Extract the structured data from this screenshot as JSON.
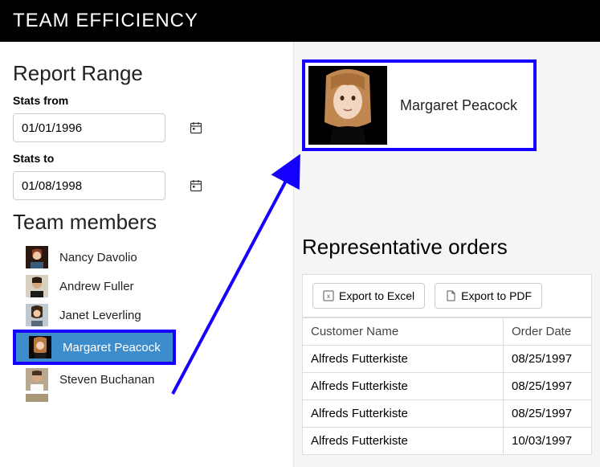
{
  "header": {
    "title": "TEAM EFFICIENCY"
  },
  "report": {
    "heading": "Report Range",
    "from_label": "Stats from",
    "from_value": "01/01/1996",
    "to_label": "Stats to",
    "to_value": "01/08/1998"
  },
  "team": {
    "heading": "Team members",
    "members": [
      {
        "name": "Nancy Davolio"
      },
      {
        "name": "Andrew Fuller"
      },
      {
        "name": "Janet Leverling"
      },
      {
        "name": "Margaret Peacock"
      },
      {
        "name": "Steven Buchanan"
      }
    ],
    "selected_index": 3
  },
  "profile": {
    "name": "Margaret Peacock"
  },
  "orders": {
    "heading": "Representative orders",
    "export_excel_label": "Export to Excel",
    "export_pdf_label": "Export to PDF",
    "columns": [
      "Customer Name",
      "Order Date"
    ],
    "rows": [
      {
        "customer": "Alfreds Futterkiste",
        "date": "08/25/1997"
      },
      {
        "customer": "Alfreds Futterkiste",
        "date": "08/25/1997"
      },
      {
        "customer": "Alfreds Futterkiste",
        "date": "08/25/1997"
      },
      {
        "customer": "Alfreds Futterkiste",
        "date": "10/03/1997"
      }
    ]
  },
  "colors": {
    "highlight": "#1500ff",
    "selected_bg": "#3d8dcc"
  }
}
